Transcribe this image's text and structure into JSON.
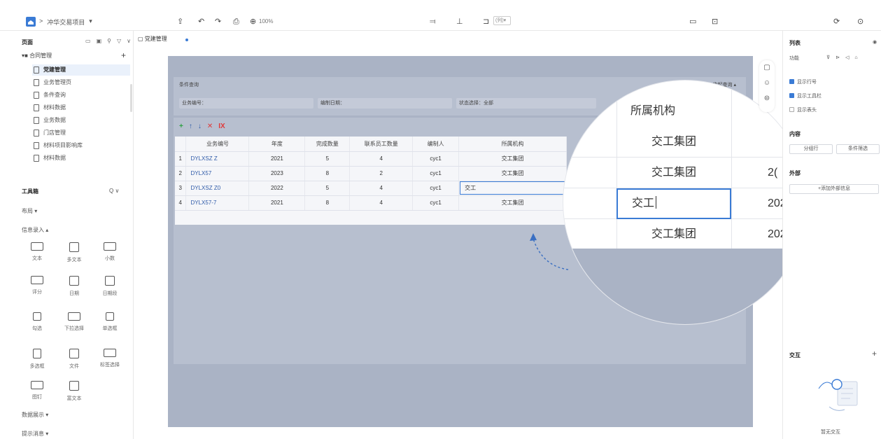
{
  "topbar": {
    "breadcrumb_sep": ">",
    "project_name": "冲华交易项目",
    "project_caret": "▾",
    "zoom": "100%",
    "column_select": "(列)▾",
    "icons": [
      "share-icon",
      "undo-icon",
      "redo-icon",
      "save-icon",
      "zoom-icon",
      "align-icon",
      "distribute-icon",
      "layout-icon",
      "preview-icon",
      "publish-icon",
      "settings-icon",
      "help-icon"
    ]
  },
  "left_panel": {
    "title": "页面",
    "tree_root": "▾■ 合同管理",
    "tree_add": "+",
    "pages": [
      {
        "label": "党建管理",
        "active": true
      },
      {
        "label": "业务管理页",
        "active": false
      },
      {
        "label": "条件查询",
        "active": false
      },
      {
        "label": "材料数据",
        "active": false
      },
      {
        "label": "业务数据",
        "active": false
      },
      {
        "label": "门店管理",
        "active": false
      },
      {
        "label": "材料项目影响库",
        "active": false
      },
      {
        "label": "材料数据",
        "active": false
      }
    ],
    "toolbox_title": "工具箱",
    "toolbox_search": "Q ∨",
    "group_layout": "布局 ▾",
    "group_input": "信息录入 ▴",
    "tools": [
      {
        "label": "文本",
        "icon": "text-input-icon"
      },
      {
        "label": "多文本",
        "icon": "textarea-icon"
      },
      {
        "label": "小数",
        "icon": "number-icon"
      },
      {
        "label": "评分",
        "icon": "rating-icon"
      },
      {
        "label": "日期",
        "icon": "date-icon"
      },
      {
        "label": "日期段",
        "icon": "date-range-icon"
      },
      {
        "label": "勾选",
        "icon": "checkbox-icon"
      },
      {
        "label": "下拉选择",
        "icon": "select-icon"
      },
      {
        "label": "单选框",
        "icon": "radio-icon"
      },
      {
        "label": "多选框",
        "icon": "multi-select-icon"
      },
      {
        "label": "文件",
        "icon": "file-icon"
      },
      {
        "label": "标签选择",
        "icon": "tag-icon"
      },
      {
        "label": "图钉",
        "icon": "pin-icon"
      },
      {
        "label": "富文本",
        "icon": "richtext-icon"
      }
    ],
    "group_display": "数据展示 ▾",
    "group_form": "提示消息 ▾"
  },
  "page_tab": {
    "label": "▢ 党建管理"
  },
  "form": {
    "title": "条件查询",
    "collapse": "收起查询 ▴",
    "fields": [
      {
        "label": "业务编号："
      },
      {
        "label": "编制日期："
      },
      {
        "label": "状态选择：全部"
      }
    ],
    "query_button": "查询"
  },
  "table": {
    "toolbar": [
      "+",
      "↑",
      "↓",
      "✕",
      "IX"
    ],
    "headers": [
      "",
      "业务编号",
      "年度",
      "完成数量",
      "联系员工数量",
      "编制人",
      "所属机构"
    ],
    "rows": [
      [
        "1",
        "DYLXSZ Z",
        "2021",
        "5",
        "4",
        "cyc1",
        "交工集团"
      ],
      [
        "2",
        "DYLX57",
        "2023",
        "8",
        "2",
        "cyc1",
        "交工集团"
      ],
      [
        "3",
        "DYLXSZ Z0",
        "2022",
        "5",
        "4",
        "cyc1",
        "交工"
      ],
      [
        "4",
        "DYLX57-7",
        "2021",
        "8",
        "4",
        "cyc1",
        "交工集团"
      ]
    ]
  },
  "zoom": {
    "header": "所属机构",
    "rows": [
      {
        "left": "交工集团",
        "right": ""
      },
      {
        "left": "交工集团",
        "right": "2("
      },
      {
        "left": "交工",
        "right": "202"
      },
      {
        "left": "交工集团",
        "right": "202"
      }
    ]
  },
  "right_panel": {
    "tab": "列表",
    "sub": "功能",
    "opt_show_row": "显示行号",
    "opt_show_toolbar": "显示工具栏",
    "opt_show_header": "显示表头",
    "content_title": "内容",
    "btn_left": "分组行",
    "btn_right": "条件筛选",
    "external_title": "外部",
    "add_external": "+添加外部信息",
    "interact_title": "交互",
    "interact_add": "+",
    "empty_hint": "暂无交互"
  }
}
